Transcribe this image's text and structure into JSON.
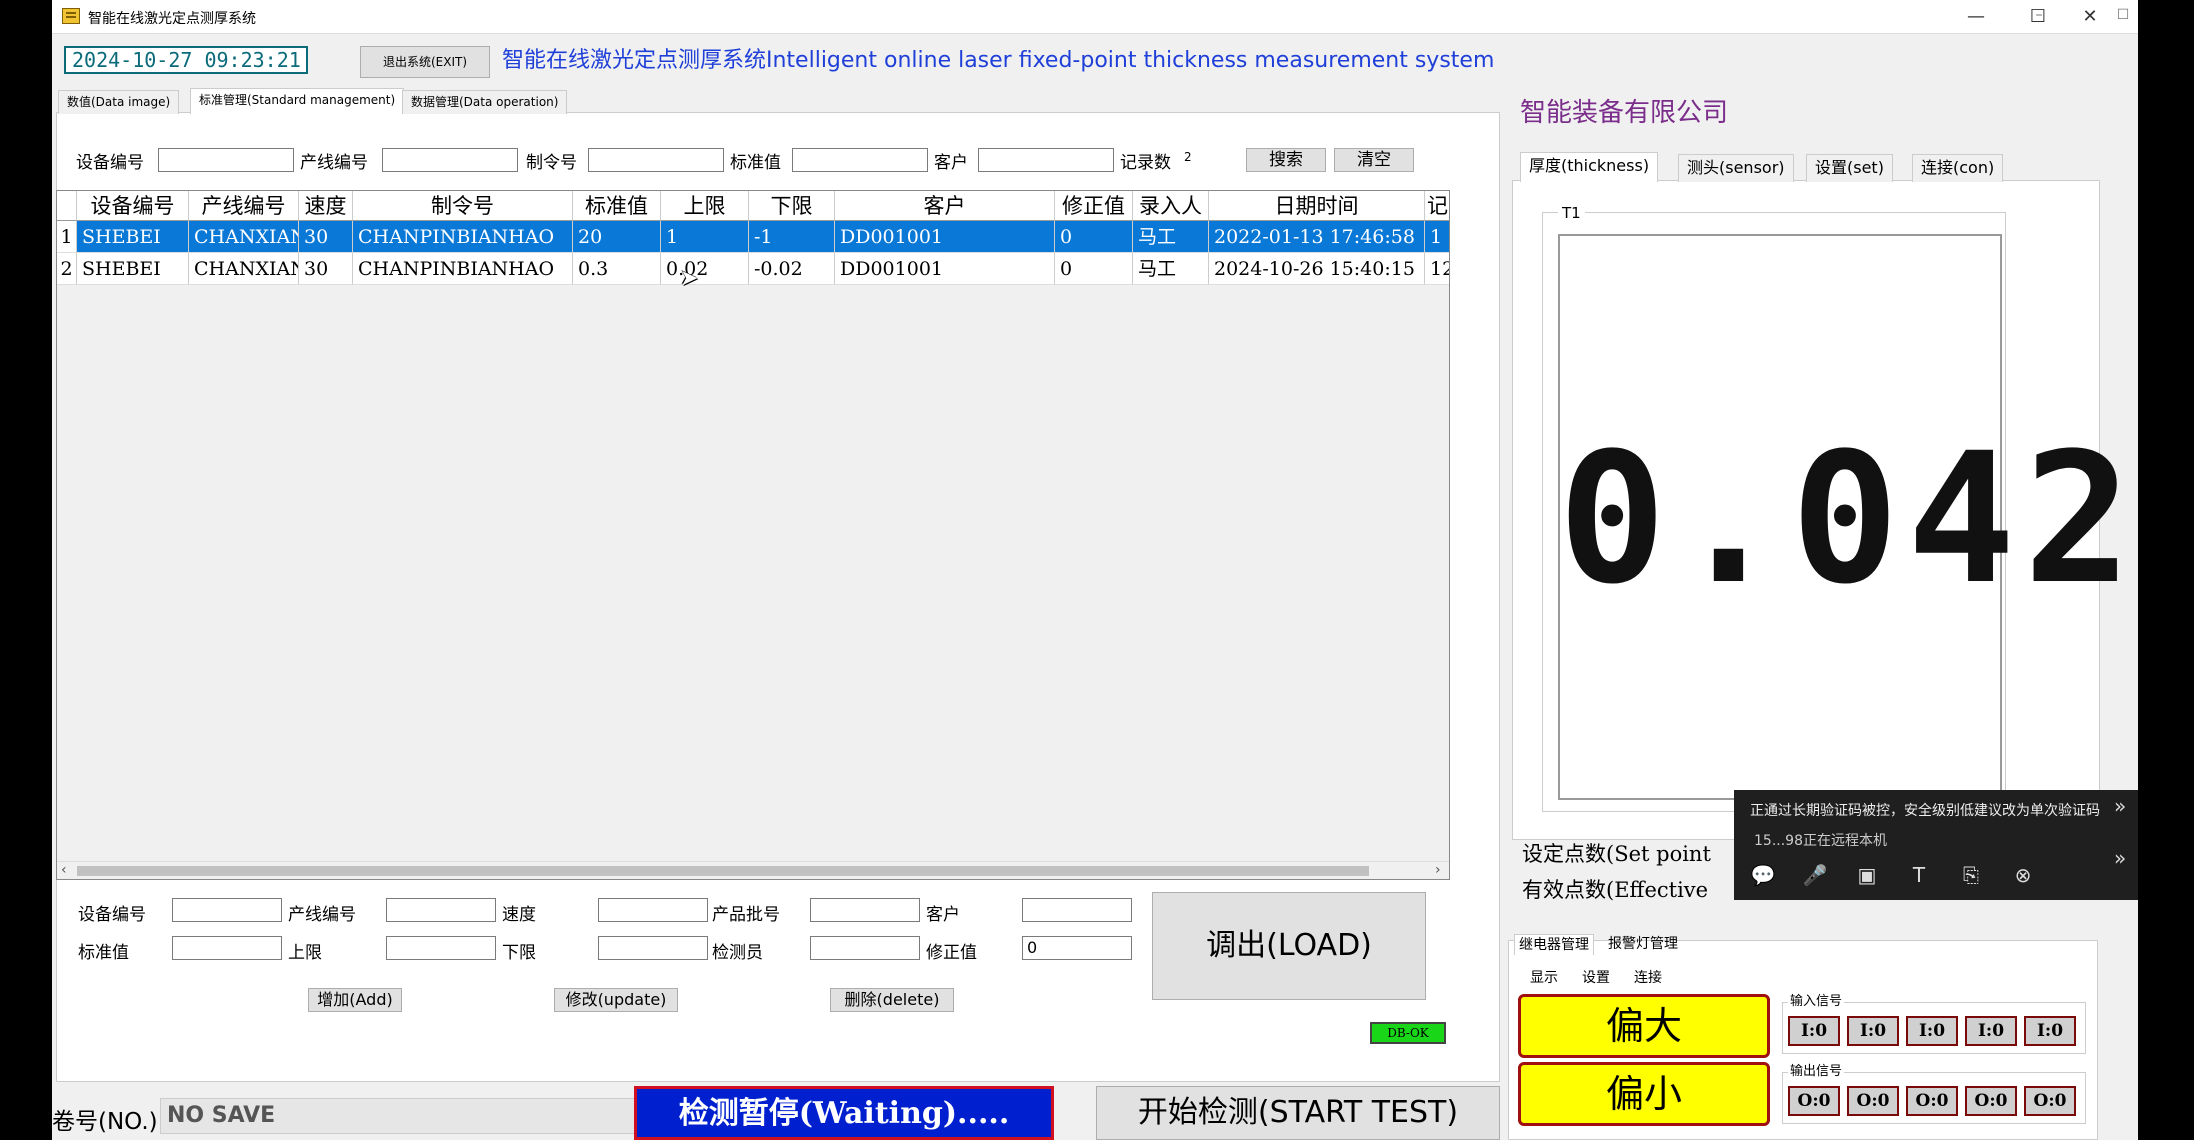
{
  "window": {
    "title": "智能在线激光定点测厚系统",
    "controls": [
      "—",
      "☐",
      "✕"
    ],
    "controls2": [
      "–",
      "☐"
    ]
  },
  "header": {
    "datetime": "2024-10-27 09:23:21",
    "exit_label": "退出系统(EXIT)",
    "system_title": "智能在线激光定点测厚系统Intelligent online laser fixed-point thickness measurement system",
    "company": "智能装备有限公司"
  },
  "main_tabs": [
    {
      "label": "数值(Data image)"
    },
    {
      "label": "标准管理(Standard management)"
    },
    {
      "label": "数据管理(Data operation)"
    }
  ],
  "search": {
    "device_label": "设备编号",
    "line_label": "产线编号",
    "order_label": "制令号",
    "std_label": "标准值",
    "customer_label": "客户",
    "count_label": "记录数",
    "count_value": "2",
    "search_label": "搜索",
    "clear_label": "清空"
  },
  "table": {
    "columns": [
      "设备编号",
      "产线编号",
      "速度",
      "制令号",
      "标准值",
      "上限",
      "下限",
      "客户",
      "修正值",
      "录入人",
      "日期时间",
      "记"
    ],
    "rows": [
      {
        "no": "1",
        "cells": [
          "SHEBEI",
          "CHANXIAN",
          "30",
          "CHANPINBIANHAO",
          "20",
          "1",
          "-1",
          "DD001001",
          "0",
          "马工",
          "2022-01-13 17:46:58",
          "1"
        ]
      },
      {
        "no": "2",
        "cells": [
          "SHEBEI",
          "CHANXIAN",
          "30",
          "CHANPINBIANHAO",
          "0.3",
          "0.02",
          "-0.02",
          "DD001001",
          "0",
          "马工",
          "2024-10-26 15:40:15",
          "12"
        ]
      }
    ]
  },
  "form": {
    "device_label": "设备编号",
    "line_label": "产线编号",
    "speed_label": "速度",
    "batch_label": "产品批号",
    "customer_label": "客户",
    "std_label": "标准值",
    "upper_label": "上限",
    "lower_label": "下限",
    "inspector_label": "检测员",
    "correction_label": "修正值",
    "correction_value": "0",
    "add_label": "增加(Add)",
    "update_label": "修改(update)",
    "delete_label": "删除(delete)",
    "load_label": "调出(LOAD)",
    "db_status": "DB-OK"
  },
  "status": {
    "roll_label": "卷号(NO.)",
    "roll_value": "NO SAVE",
    "waiting_label": "检测暂停(Waiting).....",
    "start_label": "开始检测(START TEST)"
  },
  "right_tabs": [
    {
      "label": "厚度(thickness)"
    },
    {
      "label": "测头(sensor)"
    },
    {
      "label": "设置(set)"
    },
    {
      "label": "连接(con)"
    }
  ],
  "thickness": {
    "group_label": "T1",
    "reading": "0.042",
    "set_points_label": "设定点数(Set point",
    "effective_label": "有效点数(Effective"
  },
  "relay": {
    "tabs": [
      "继电器管理",
      "报警灯管理"
    ],
    "sub_tabs": [
      "显示",
      "设置",
      "连接"
    ],
    "too_large_label": "偏大",
    "too_small_label": "偏小",
    "input_title": "输入信号",
    "output_title": "输出信号",
    "inputs": [
      "I:0",
      "I:0",
      "I:0",
      "I:0",
      "I:0"
    ],
    "outputs": [
      "O:0",
      "O:0",
      "O:0",
      "O:0",
      "O:0"
    ]
  },
  "remote": {
    "message": "正通过长期验证码被控，安全级别低建议改为单次验证码",
    "who": "15...98正在远程本机"
  },
  "colors": {
    "accent_blue": "#1f3fd9",
    "company_purple": "#7a2d8a",
    "selected_row": "#0a78d7",
    "waiting_bg": "#0020d0",
    "warn_yellow": "#ffff00",
    "db_ok_green": "#19d619"
  }
}
